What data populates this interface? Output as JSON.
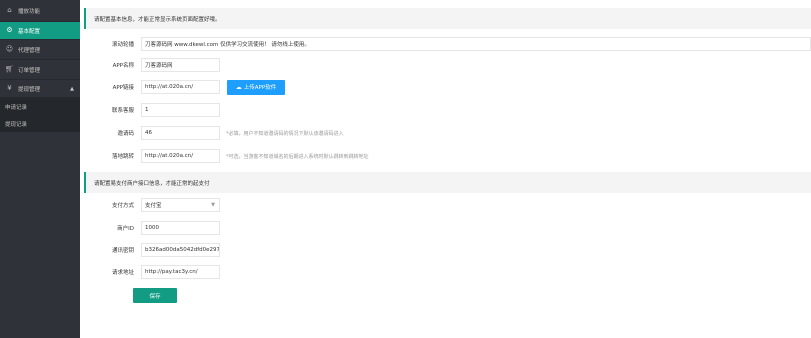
{
  "sidebar": {
    "items": [
      {
        "label": "播放功能",
        "icon": "home-icon"
      },
      {
        "label": "基本配置",
        "icon": "gear-icon",
        "active": true
      },
      {
        "label": "代理管理",
        "icon": "user-icon"
      },
      {
        "label": "订单管理",
        "icon": "cart-icon"
      },
      {
        "label": "提现管理",
        "icon": "money-icon",
        "caret": "▲"
      }
    ],
    "sub_items": [
      {
        "label": "申请记录"
      },
      {
        "label": "提现记录"
      }
    ]
  },
  "section1": {
    "notice": "请配置基本信息，才能正常显示系统页面配置好哦。",
    "fields": {
      "marquee": {
        "label": "滚动轮播",
        "value": "刀客源码网  www.dkewl.com   仅供学习交流使用！ 请勿线上使用。"
      },
      "app_name": {
        "label": "APP名称",
        "value": "刀客源码网"
      },
      "app_link": {
        "label": "APP链接",
        "value": "http://at.020a.cn/",
        "button": "上传APP软件"
      },
      "contact": {
        "label": "联系客服",
        "value": "1"
      },
      "invite_code": {
        "label": "邀请码",
        "value": "46",
        "hint": "*必填，用户不知道邀请码的情况下默认该邀请码进入"
      },
      "redirect": {
        "label": "落地跳转",
        "value": "http://at.020a.cn/",
        "hint": "*可选，当游客不知道域名的后期进入系统时默认跳转到跳转地址"
      }
    }
  },
  "section2": {
    "notice": "请配置易支付商户接口信息，才能正常的起支付",
    "fields": {
      "pay_method": {
        "label": "支付方式",
        "value": "支付宝"
      },
      "merchant_id": {
        "label": "商户ID",
        "value": "1000"
      },
      "secret": {
        "label": "通讯密钥",
        "value": "b326ad00da5042dfd0e2972"
      },
      "api_url": {
        "label": "请求地址",
        "value": "http://pay.tac3y.cn/"
      }
    },
    "save_label": "保存"
  },
  "colors": {
    "accent": "#129c83",
    "upload": "#1e9fff",
    "sidebar": "#2f3238"
  }
}
